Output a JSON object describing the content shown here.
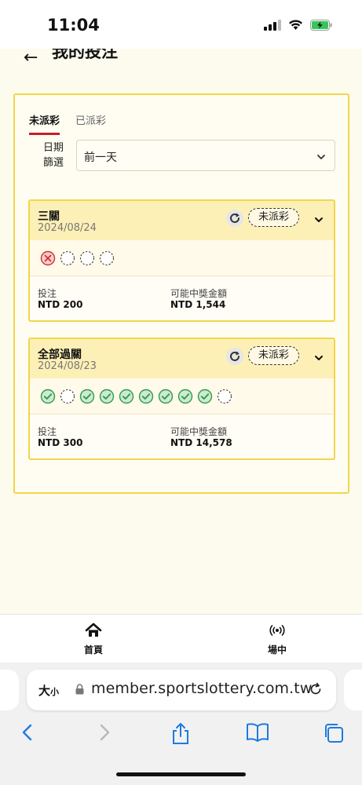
{
  "status_bar": {
    "time": "11:04"
  },
  "header": {
    "back_glyph": "←",
    "title": "我的投注"
  },
  "tabs": [
    {
      "label": "未派彩",
      "active": true
    },
    {
      "label": "已派彩",
      "active": false
    }
  ],
  "filter": {
    "label_line1": "日期",
    "label_line2": "篩選",
    "value": "前一天"
  },
  "bets": [
    {
      "type": "三關",
      "date": "2024/08/24",
      "status": "未派彩",
      "legs": [
        "lost",
        "pending",
        "pending",
        "pending"
      ],
      "stake_label": "投注",
      "stake_value": "NTD 200",
      "payout_label": "可能中獎金額",
      "payout_value": "NTD 1,544"
    },
    {
      "type": "全部過關",
      "date": "2024/08/23",
      "status": "未派彩",
      "legs": [
        "won",
        "pending",
        "won",
        "won",
        "won",
        "won",
        "won",
        "won",
        "won",
        "pending"
      ],
      "stake_label": "投注",
      "stake_value": "NTD 300",
      "payout_label": "可能中獎金額",
      "payout_value": "NTD 14,578"
    }
  ],
  "bottom_nav": [
    {
      "label": "首頁",
      "icon": "home-icon"
    },
    {
      "label": "場中",
      "icon": "live-broadcast-icon"
    }
  ],
  "browser": {
    "text_size_label": "大小",
    "url": "member.sportslottery.com.tw"
  },
  "colors": {
    "accent_red": "#c41e2b",
    "border_yellow": "#f2d54c",
    "won_green": "#2e9e4a",
    "lost_red": "#d32f2f"
  }
}
